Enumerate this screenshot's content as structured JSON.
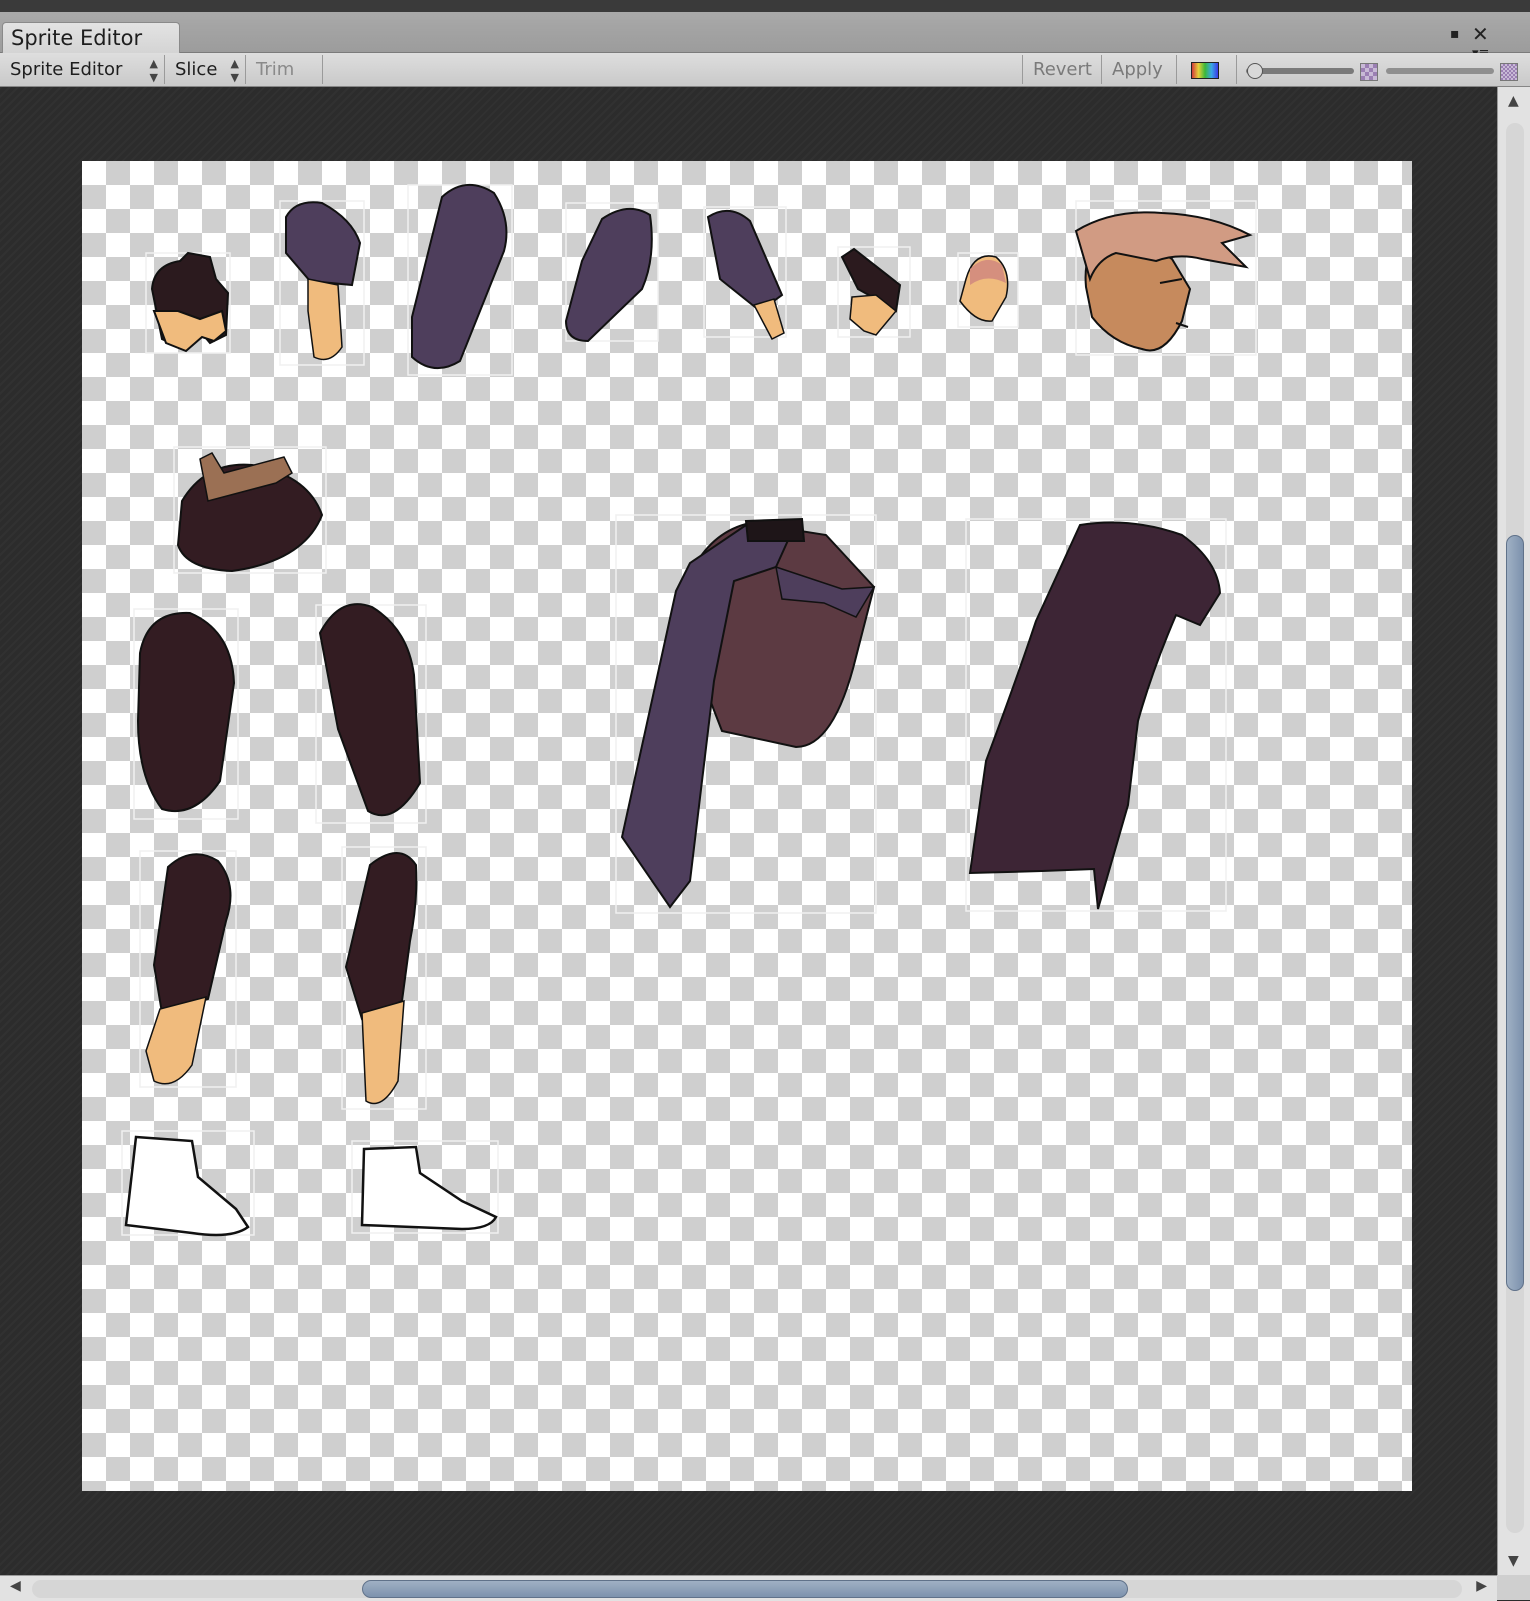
{
  "window": {
    "tab_title": "Sprite Editor"
  },
  "toolbar": {
    "mode_label": "Sprite Editor",
    "slice_label": "Slice",
    "trim_label": "Trim",
    "revert_label": "Revert",
    "apply_label": "Apply",
    "zoom_level": 0.05,
    "mip_level": 1.0
  },
  "scroll": {
    "vertical_position": 0.42,
    "horizontal_position": 0.24
  },
  "colors": {
    "tab_bg": "#d9d9d9",
    "toolbar_bg": "#d2d2d2",
    "canvas_bg": "#2c2c2c",
    "checker_dark": "#cfcfcf",
    "checker_light": "#ffffff",
    "cloth_purple": "#4e3e5c",
    "cloth_dark": "#331c22",
    "coat_purple": "#3d2535",
    "skin": "#f0bb7d",
    "scrollbar_thumb": "#8fa2ba"
  },
  "sprites": [
    {
      "name": "hand-fist-icon"
    },
    {
      "name": "upper-arm-sleeve-icon"
    },
    {
      "name": "sleeve-large-icon"
    },
    {
      "name": "sleeve-small-icon"
    },
    {
      "name": "forearm-sleeve-icon"
    },
    {
      "name": "hand-small-icon"
    },
    {
      "name": "thumb-icon"
    },
    {
      "name": "head-icon"
    },
    {
      "name": "hips-belt-icon"
    },
    {
      "name": "thigh-left-icon"
    },
    {
      "name": "thigh-right-icon"
    },
    {
      "name": "torso-jacket-icon"
    },
    {
      "name": "coat-back-icon"
    },
    {
      "name": "shin-left-icon"
    },
    {
      "name": "shin-right-icon"
    },
    {
      "name": "shoe-left-icon"
    },
    {
      "name": "shoe-right-icon"
    }
  ]
}
